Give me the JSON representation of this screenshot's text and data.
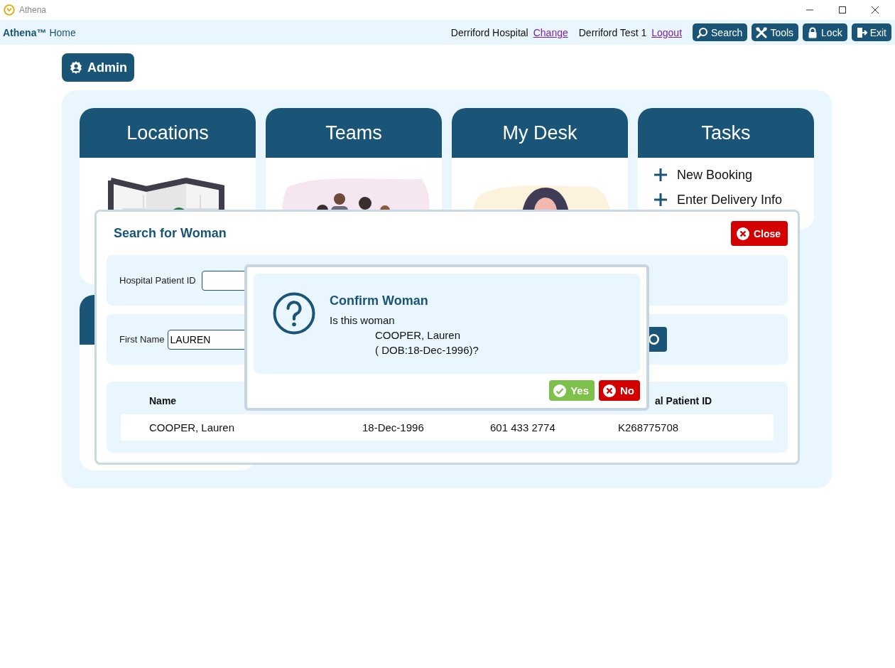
{
  "window": {
    "title": "Athena"
  },
  "toolbar": {
    "brand": "Athena™",
    "page": "Home",
    "hospital": "Derriford Hospital",
    "change_link": "Change",
    "user": "Derriford Test 1",
    "logout_link": "Logout",
    "buttons": [
      {
        "label": "Search",
        "kind": "search"
      },
      {
        "label": "Tools",
        "kind": "tools"
      },
      {
        "label": "Lock",
        "kind": "lock"
      },
      {
        "label": "Exit",
        "kind": "exit"
      }
    ]
  },
  "admin_button": {
    "label": "Admin"
  },
  "cards": [
    {
      "title": "Locations",
      "kind": "map"
    },
    {
      "title": "Teams",
      "kind": "team"
    },
    {
      "title": "My Desk",
      "kind": "desk"
    },
    {
      "title": "Tasks",
      "kind": "tasks",
      "tasks": [
        "New Booking",
        "Enter Delivery Info"
      ]
    }
  ],
  "search_dialog": {
    "title": "Search for Woman",
    "close_button": "Close",
    "fields": [
      {
        "label": "Hospital Patient ID"
      },
      {
        "label": "First Name",
        "value": "LAUREN"
      }
    ],
    "results": {
      "columns": {
        "column_1": "Name",
        "column_4": "al Patient ID"
      },
      "rows": [
        [
          "COOPER, Lauren",
          "18-Dec-1996",
          "601 433 2774",
          "K268775708"
        ]
      ]
    }
  },
  "confirm_dialog": {
    "title": "Confirm Woman",
    "message": "Is this woman",
    "name": "COOPER, Lauren",
    "dob": "( DOB:18-Dec-1996)?",
    "buttons": [
      {
        "label": "Yes",
        "kind": "yes"
      },
      {
        "label": "No",
        "kind": "no"
      }
    ]
  }
}
